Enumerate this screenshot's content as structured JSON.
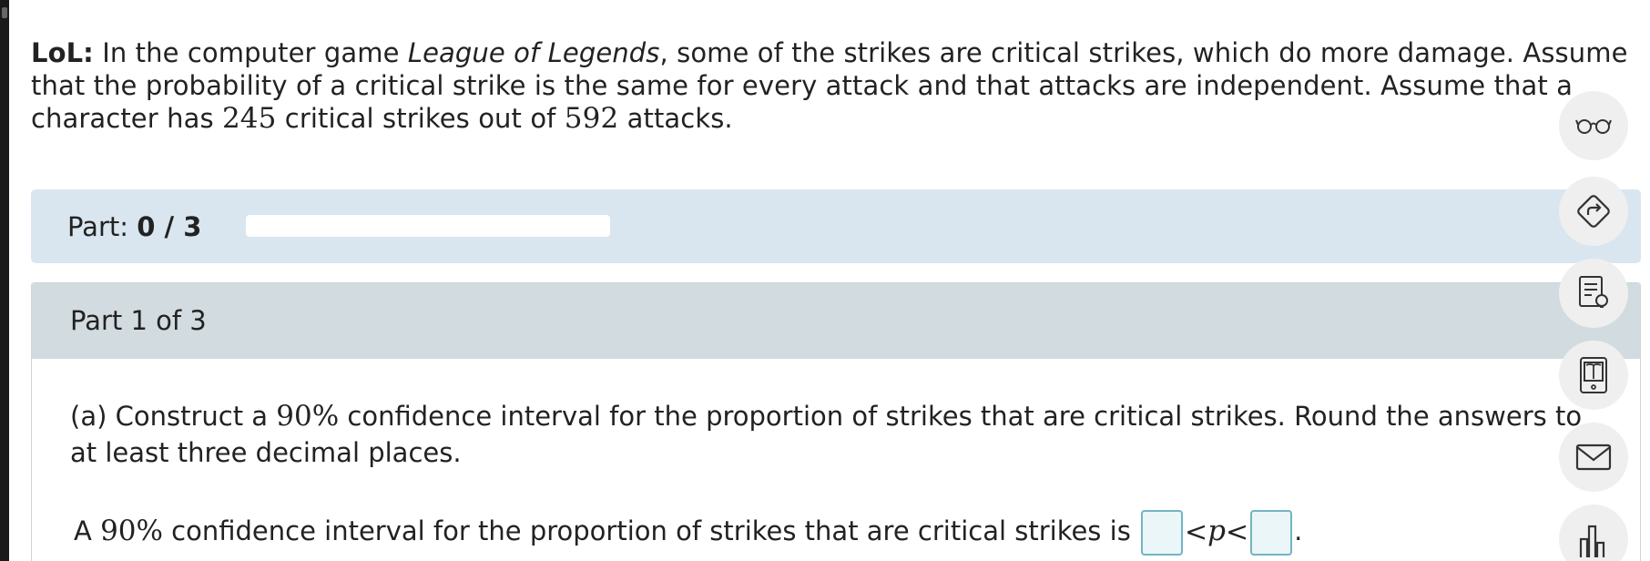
{
  "problem": {
    "label": "LoL:",
    "text_before_game": " In the computer game ",
    "game_name": "League of Legends",
    "text_after_game": ", some of the strikes are critical strikes, which do more damage. Assume that the probability of a critical strike is the same for every attack and that attacks are independent. Assume that a character has ",
    "critical_count": "245",
    "text_mid": " critical strikes out of ",
    "attack_count": "592",
    "text_end": " attacks."
  },
  "progress": {
    "label": "Part: ",
    "value": "0 / 3",
    "completed": 0,
    "total": 3
  },
  "part": {
    "title": "Part 1 of 3",
    "question_before": "(a) Construct a ",
    "confidence": "90%",
    "question_after": " confidence interval for the proportion of strikes that are critical strikes. Round the answers to at least three decimal places.",
    "answer_before": "A ",
    "answer_confidence": "90%",
    "answer_after": " confidence interval for the proportion of strikes that are critical strikes is ",
    "lower_value": "",
    "less_than_1": "<",
    "variable": "p",
    "less_than_2": "<",
    "upper_value": "",
    "period": "."
  },
  "toolbar": {
    "icons": [
      "glasses-icon",
      "share-arrow-icon",
      "notes-lightbulb-icon",
      "ebook-icon",
      "mail-icon",
      "bar-chart-icon"
    ]
  },
  "colors": {
    "progress_bg": "#dae6ef",
    "part_header_bg": "#d2dbe0",
    "answer_box_border": "#74b4c2",
    "toolbar_button_bg": "#efefef"
  }
}
